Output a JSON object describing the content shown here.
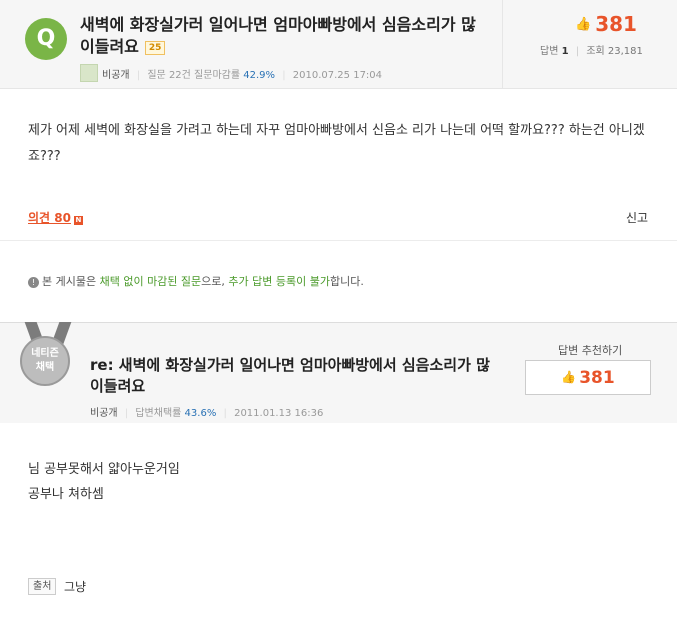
{
  "question": {
    "icon_letter": "Q",
    "title": "새벽에 화장실가러 일어나면 엄마아빠방에서 심음소리가 많이들려요",
    "badge": "25",
    "likes": "381",
    "answers_label": "답변",
    "answers_count": "1",
    "views_label": "조회",
    "views_count": "23,181",
    "author": "비공개",
    "stats_prefix": "질문 22건 질문마감률",
    "close_rate": "42.9%",
    "date": "2010.07.25 17:04",
    "body": "제가 어제 세벽에 화장실을 가려고 하는데 자꾸 엄마아빠방에서 신음소 리가 나는데 어떡 할까요???        하는건 아니겠죠???",
    "opinions_label": "의견 80",
    "opinions_badge": "N",
    "report_label": "신고"
  },
  "notice": {
    "icon": "!",
    "prefix": "본 게시물은 ",
    "part1": "채택 없이 마감된 질문",
    "mid": "으로, ",
    "part2": "추가 답변 등록이 불가",
    "suffix": "합니다."
  },
  "answer": {
    "medal_line1": "네티즌",
    "medal_line2": "채택",
    "title": "re: 새벽에 화장실가러 일어나면 엄마아빠방에서 심음소리가 많이들려요",
    "recommend_label": "답변 추천하기",
    "recommend_count": "381",
    "author": "비공개",
    "stats_prefix": "답변채택률",
    "adopt_rate": "43.6%",
    "date": "2011.01.13 16:36",
    "body_line1": "님 공부못해서 얇아누운거임",
    "body_line2": "공부나 쳐하셈",
    "source_label": "출처",
    "source_value": "그냥"
  }
}
